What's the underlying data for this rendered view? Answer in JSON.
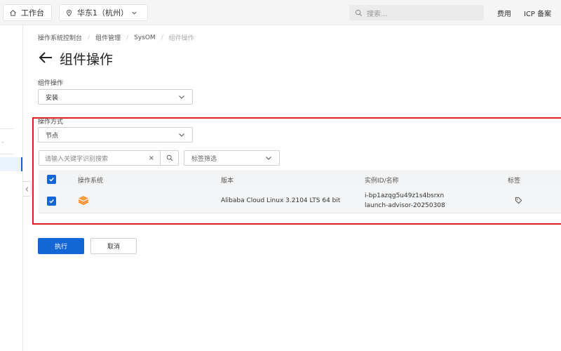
{
  "topbar": {
    "workbench_label": "工作台",
    "region_label": "华东1（杭州）",
    "search_placeholder": "搜索...",
    "fee_label": "费用",
    "icp_label": "ICP 备案"
  },
  "sidebar": {
    "partial_marker": "-"
  },
  "breadcrumb": {
    "items": [
      "操作系统控制台",
      "组件管理",
      "SysOM",
      "组件操作"
    ],
    "separator": "/"
  },
  "page": {
    "title": "组件操作"
  },
  "form": {
    "operation_label": "组件操作",
    "operation_value": "安装",
    "method_label": "操作方式",
    "method_value": "节点"
  },
  "filter": {
    "keyword_placeholder": "请输入关键字识别搜索",
    "clear_glyph": "×",
    "tag_filter_label": "标签筛选"
  },
  "table": {
    "headers": [
      "操作系统",
      "版本",
      "实例ID/名称",
      "标签"
    ],
    "rows": [
      {
        "version": "Alibaba Cloud Linux  3.2104 LTS 64 bit",
        "instance_id": "i-bp1azqg5u49z1s4bsrxn",
        "instance_name": "launch-advisor-20250308",
        "os_icon": "alibaba-cloud-linux-icon",
        "tag_icon": "tag-icon"
      }
    ]
  },
  "actions": {
    "execute_label": "执行",
    "cancel_label": "取消"
  },
  "colors": {
    "primary": "#1366d6",
    "highlight_border": "#e02020",
    "os_icon": "#ff7a00"
  }
}
